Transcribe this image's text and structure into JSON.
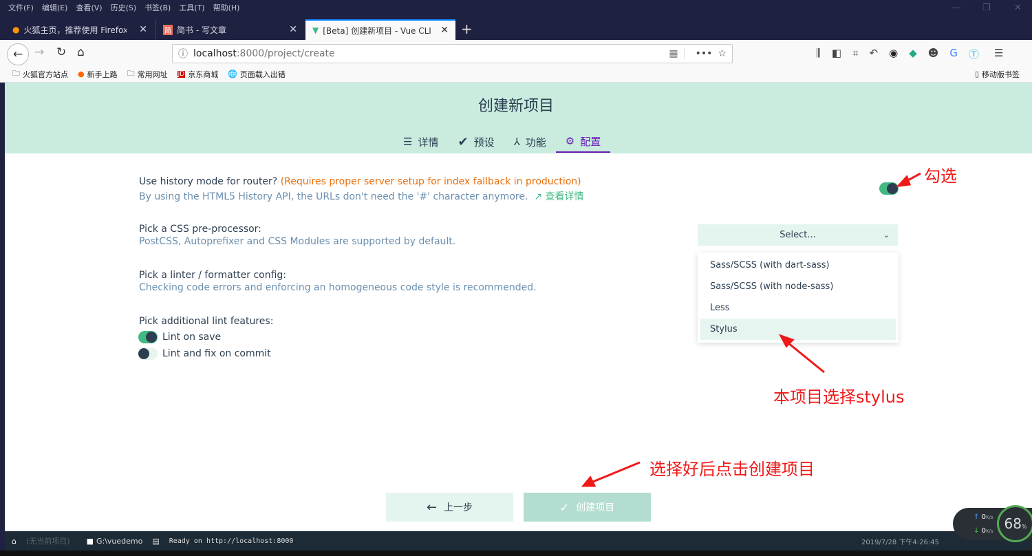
{
  "browser": {
    "menu": [
      "文件(F)",
      "编辑(E)",
      "查看(V)",
      "历史(S)",
      "书签(B)",
      "工具(T)",
      "帮助(H)"
    ],
    "tabs": [
      {
        "label": "火狐主页，推荐使用 Firefox 火"
      },
      {
        "label": "简书 - 写文章"
      },
      {
        "label": "[Beta] 创建新项目 - Vue CLI",
        "active": true
      }
    ],
    "url_host": "localhost",
    "url_path": ":8000/project/create",
    "bookmarks": [
      "火狐官方站点",
      "新手上路",
      "常用网址",
      "京东商城",
      "页面载入出错"
    ],
    "mobile_bookmarks": "移动版书签"
  },
  "page": {
    "title": "创建新项目",
    "steps": [
      {
        "label": "详情",
        "icon": "list-icon"
      },
      {
        "label": "预设",
        "icon": "check-circle-icon"
      },
      {
        "label": "功能",
        "icon": "fork-icon"
      },
      {
        "label": "配置",
        "icon": "gear-icon",
        "active": true
      }
    ],
    "history": {
      "question": "Use history mode for router?",
      "warning": "(Requires proper server setup for index fallback in production)",
      "desc": "By using the HTML5 History API, the URLs don't need the '#' character anymore.",
      "link": "查看详情",
      "enabled": true
    },
    "css": {
      "question": "Pick a CSS pre-processor:",
      "desc": "PostCSS, Autoprefixer and CSS Modules are supported by default.",
      "placeholder": "Select...",
      "options": [
        "Sass/SCSS (with dart-sass)",
        "Sass/SCSS (with node-sass)",
        "Less",
        "Stylus"
      ],
      "highlighted": "Stylus"
    },
    "linter": {
      "question": "Pick a linter / formatter config:",
      "desc": "Checking code errors and enforcing an homogeneous code style is recommended."
    },
    "lint_features": {
      "question": "Pick additional lint features:",
      "items": [
        {
          "label": "Lint on save",
          "enabled": true
        },
        {
          "label": "Lint and fix on commit",
          "enabled": false
        }
      ]
    },
    "prev_button": "上一步",
    "create_button": "创建项目"
  },
  "annotations": {
    "check": "勾选",
    "stylus": "本项目选择stylus",
    "create": "选择好后点击创建项目",
    "color": "#f01919"
  },
  "statusbar": {
    "project": "(无当前项目)",
    "folder": "G:\\vuedemo",
    "log": "Ready on http://localhost:8000",
    "datetime": "2019/7/28 下午4:26:45"
  },
  "netmon": {
    "up": "0",
    "down": "0",
    "unit": "K/s",
    "percent": "68"
  },
  "colors": {
    "accent": "#42b983",
    "header_bg": "#c9ecdf",
    "active_step": "#6a1bb4"
  }
}
